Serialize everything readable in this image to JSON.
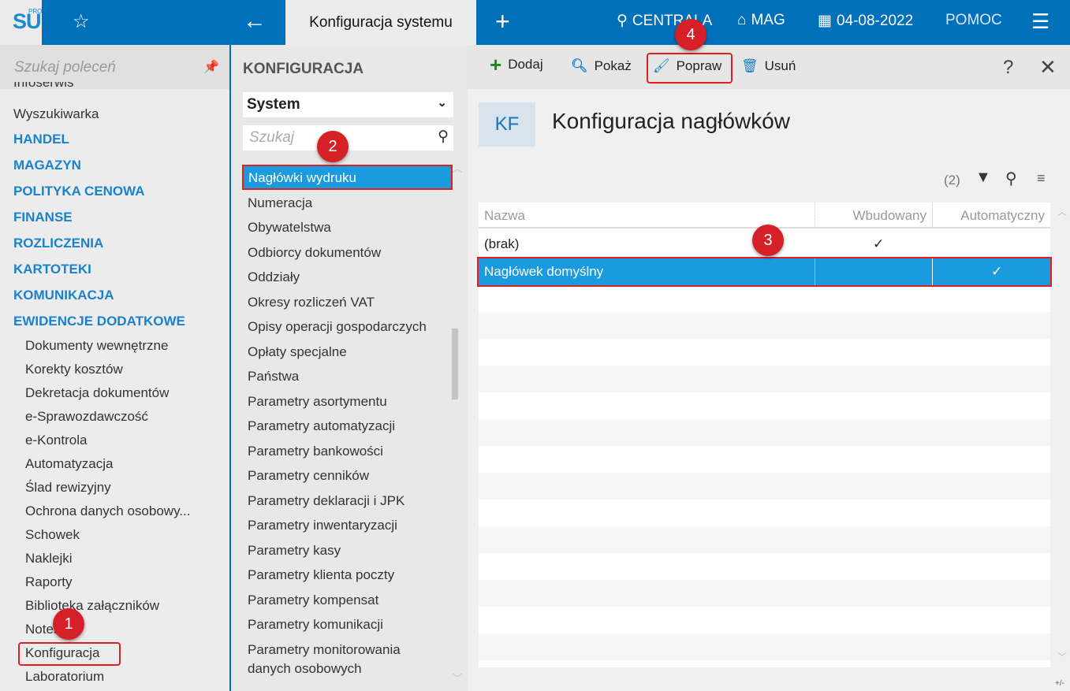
{
  "app": {
    "logo": "SU",
    "logo_sup": "PRO",
    "active_tab": "Konfiguracja systemu"
  },
  "topbar": {
    "company": "CENTRALA",
    "warehouse": "MAG",
    "date": "04-08-2022",
    "help": "POMOC"
  },
  "sidebar": {
    "search_placeholder": "Szukaj poleceń",
    "cut_item": "Infoserwis",
    "items": [
      "Wyszukiwarka"
    ],
    "sections": [
      "HANDEL",
      "MAGAZYN",
      "POLITYKA CENOWA",
      "FINANSE",
      "ROZLICZENIA",
      "KARTOTEKI",
      "KOMUNIKACJA",
      "EWIDENCJE DODATKOWE"
    ],
    "subitems": [
      "Dokumenty wewnętrzne",
      "Korekty kosztów",
      "Dekretacja dokumentów",
      "e-Sprawozdawczość",
      "e-Kontrola",
      "Automatyzacja",
      "Ślad rewizyjny",
      "Ochrona danych osobowy...",
      "Schowek",
      "Naklejki",
      "Raporty",
      "Biblioteka załączników",
      "Notes",
      "Konfiguracja",
      "Laboratorium"
    ]
  },
  "middle": {
    "title": "KONFIGURACJA",
    "select": "System",
    "search_placeholder": "Szukaj",
    "active": "Nagłówki wydruku",
    "items": [
      "Numeracja",
      "Obywatelstwa",
      "Odbiorcy dokumentów",
      "Oddziały",
      "Okresy rozliczeń VAT",
      "Opisy operacji gospodarczych",
      "Opłaty specjalne",
      "Państwa",
      "Parametry asortymentu",
      "Parametry automatyzacji",
      "Parametry bankowości",
      "Parametry cenników",
      "Parametry deklaracji i JPK",
      "Parametry inwentaryzacji",
      "Parametry kasy",
      "Parametry klienta poczty",
      "Parametry kompensat",
      "Parametry komunikacji",
      "Parametry monitorowania",
      "danych osobowych"
    ]
  },
  "toolbar": {
    "add": "Dodaj",
    "show": "Pokaż",
    "edit": "Popraw",
    "delete": "Usuń",
    "help": "?"
  },
  "content": {
    "badge": "KF",
    "title": "Konfiguracja nagłówków",
    "count": "(2)",
    "columns": [
      "Nazwa",
      "Wbudowany",
      "Automatyczny"
    ],
    "rows": [
      {
        "name": "(brak)",
        "builtin": "✓",
        "auto": ""
      },
      {
        "name": "Nagłówek domyślny",
        "builtin": "",
        "auto": "✓"
      }
    ],
    "footer": "+/-"
  },
  "annotations": [
    "1",
    "2",
    "3",
    "4"
  ],
  "colors": {
    "brand": "#0070ba",
    "selection": "#1a9be0",
    "highlight": "#e02020"
  }
}
